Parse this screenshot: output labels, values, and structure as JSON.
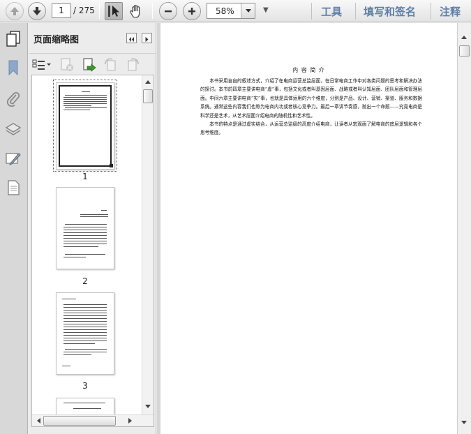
{
  "toolbar": {
    "current_page": "1",
    "page_total": "/ 275",
    "zoom_value": "58%",
    "more_glyph": "▼",
    "right_links": [
      "工具",
      "填写和签名",
      "注释"
    ]
  },
  "panel": {
    "title": "页面缩略图",
    "thumbnails": [
      {
        "label": "1"
      },
      {
        "label": "2"
      },
      {
        "label": "3"
      }
    ]
  },
  "document": {
    "title": "内 容 简 介",
    "paragraphs": [
      "本书采用自自的叙述方式，介绍了在电商运营总监层面，在日常电商工作中对各类问题的思考和解决办法的探讨。本书前四章主要讲电商“虚”事，包括文化或者叫基因层面、战略或者叫认知层面、团队层面和管理层面。中间六章主要讲电商“实”事，也就是具体运用的六个维度，分别是产品、设计、营销、渠道、服务和数据系统。通常这些内容我们也称为电商内功或者核心竞争力。最后一章讲节奏感，抛出一个命题——究竟电商是科学还是艺术，从艺术层面介绍电商的随机性和艺术性。",
      "本书的特点是通过虚实结合，从运营总监级的高度介绍电商，让读者从宏观面了解电商的底层逻辑和各个思考维度。"
    ]
  },
  "colors": {
    "link_blue": "#5d7ea8",
    "rail_bg": "#d8d8d8",
    "rail_icon": "#7f9bc0"
  },
  "icons": [
    "up-arrow-icon",
    "down-arrow-icon",
    "select-cursor-icon",
    "hand-icon",
    "zoom-out-icon",
    "zoom-in-icon",
    "pages-icon",
    "bookmark-icon",
    "paperclip-icon",
    "layers-icon",
    "signature-icon",
    "document-icon"
  ]
}
